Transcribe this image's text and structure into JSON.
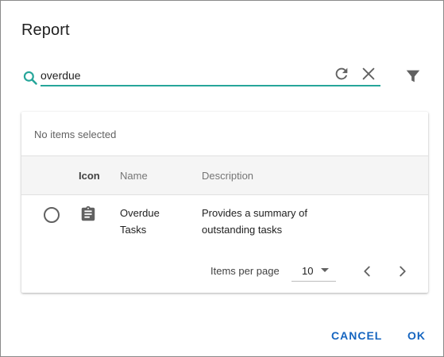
{
  "dialog": {
    "title": "Report"
  },
  "search": {
    "value": "overdue",
    "accent_color": "#26a69a"
  },
  "icons": {
    "search": "search-icon",
    "refresh": "refresh-icon",
    "clear": "close-icon",
    "filter": "filter-icon",
    "row": "clipboard-icon",
    "prev": "chevron-left-icon",
    "next": "chevron-right-icon"
  },
  "table": {
    "selection_text": "No items selected",
    "columns": [
      "Icon",
      "Name",
      "Description"
    ],
    "rows": [
      {
        "name": "Overdue Tasks",
        "description": "Provides a summary of outstanding tasks",
        "selected": false
      }
    ]
  },
  "paginator": {
    "items_per_page_label": "Items per page",
    "page_size": "10"
  },
  "actions": {
    "cancel": "CANCEL",
    "ok": "OK",
    "color": "#1565c0"
  }
}
